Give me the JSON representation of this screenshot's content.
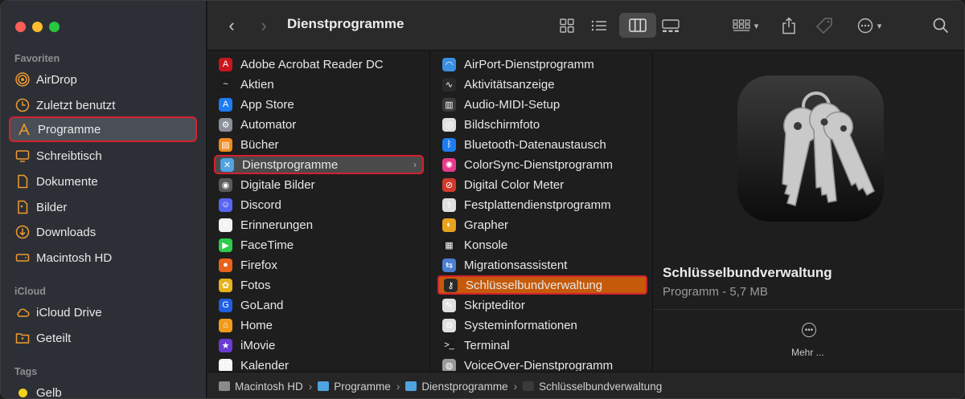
{
  "sidebar": {
    "sections": [
      {
        "label": "Favoriten"
      },
      {
        "label": "iCloud"
      },
      {
        "label": "Tags"
      }
    ],
    "favorites": [
      {
        "label": "AirDrop",
        "icon": "airdrop-icon"
      },
      {
        "label": "Zuletzt benutzt",
        "icon": "clock-icon"
      },
      {
        "label": "Programme",
        "icon": "applications-icon",
        "selected": true
      },
      {
        "label": "Schreibtisch",
        "icon": "desktop-icon"
      },
      {
        "label": "Dokumente",
        "icon": "document-icon"
      },
      {
        "label": "Bilder",
        "icon": "pictures-icon"
      },
      {
        "label": "Downloads",
        "icon": "downloads-icon"
      },
      {
        "label": "Macintosh HD",
        "icon": "harddrive-icon"
      }
    ],
    "icloud": [
      {
        "label": "iCloud Drive",
        "icon": "cloud-icon"
      },
      {
        "label": "Geteilt",
        "icon": "shared-folder-icon"
      }
    ],
    "tags": [
      {
        "label": "Gelb",
        "color": "#f2d11c"
      }
    ]
  },
  "toolbar": {
    "title": "Dienstprogramme"
  },
  "column1": [
    {
      "label": "Adobe Acrobat Reader DC",
      "color": "#c8161d",
      "glyph": "A"
    },
    {
      "label": "Aktien",
      "color": "#1c1c1c",
      "glyph": "~"
    },
    {
      "label": "App Store",
      "color": "#1e7cf2",
      "glyph": "A"
    },
    {
      "label": "Automator",
      "color": "#8a8f99",
      "glyph": "⚙"
    },
    {
      "label": "Bücher",
      "color": "#f08a1c",
      "glyph": "▤"
    },
    {
      "label": "Dienstprogramme",
      "color": "#4fa3e0",
      "glyph": "✕",
      "selected": true
    },
    {
      "label": "Digitale Bilder",
      "color": "#5a5a5a",
      "glyph": "◉"
    },
    {
      "label": "Discord",
      "color": "#5865f2",
      "glyph": "☺"
    },
    {
      "label": "Erinnerungen",
      "color": "#f2f2f2",
      "glyph": "≡"
    },
    {
      "label": "FaceTime",
      "color": "#2ecc4a",
      "glyph": "▶"
    },
    {
      "label": "Firefox",
      "color": "#e8621c",
      "glyph": "●"
    },
    {
      "label": "Fotos",
      "color": "#e8b21c",
      "glyph": "✿"
    },
    {
      "label": "GoLand",
      "color": "#1f5fe0",
      "glyph": "G"
    },
    {
      "label": "Home",
      "color": "#f29a1c",
      "glyph": "⌂"
    },
    {
      "label": "iMovie",
      "color": "#6a3bd1",
      "glyph": "★"
    },
    {
      "label": "Kalender",
      "color": "#f5f5f5",
      "glyph": "17"
    }
  ],
  "column2": [
    {
      "label": "AirPort-Dienstprogramm",
      "color": "#3b8fe0",
      "glyph": "◠"
    },
    {
      "label": "Aktivitätsanzeige",
      "color": "#2a2a2a",
      "glyph": "∿"
    },
    {
      "label": "Audio-MIDI-Setup",
      "color": "#3a3a3a",
      "glyph": "▥"
    },
    {
      "label": "Bildschirmfoto",
      "color": "#e0e0e0",
      "glyph": "◎"
    },
    {
      "label": "Bluetooth-Datenaustausch",
      "color": "#1e7cf2",
      "glyph": "ᛒ"
    },
    {
      "label": "ColorSync-Dienstprogramm",
      "color": "#e83a8a",
      "glyph": "✺"
    },
    {
      "label": "Digital Color Meter",
      "color": "#d13a2a",
      "glyph": "⊘"
    },
    {
      "label": "Festplattendienstprogramm",
      "color": "#e0e0e0",
      "glyph": "⚕"
    },
    {
      "label": "Grapher",
      "color": "#e8a21c",
      "glyph": "◐"
    },
    {
      "label": "Konsole",
      "color": "#1c1c1c",
      "glyph": "▦"
    },
    {
      "label": "Migrationsassistent",
      "color": "#4a7fd1",
      "glyph": "⇆"
    },
    {
      "label": "Schlüsselbundverwaltung",
      "color": "#2a2a2a",
      "glyph": "⚷",
      "selected": true
    },
    {
      "label": "Skripteditor",
      "color": "#e0e0e0",
      "glyph": "✎"
    },
    {
      "label": "Systeminformationen",
      "color": "#e0e0e0",
      "glyph": "⚙"
    },
    {
      "label": "Terminal",
      "color": "#1c1c1c",
      "glyph": ">_"
    },
    {
      "label": "VoiceOver-Dienstprogramm",
      "color": "#9a9a9a",
      "glyph": "◍"
    }
  ],
  "preview": {
    "name": "Schlüsselbundverwaltung",
    "subtitle": "Programm - 5,7 MB",
    "more_label": "Mehr ..."
  },
  "pathbar": [
    {
      "label": "Macintosh HD",
      "color": "#8a8a8a"
    },
    {
      "label": "Programme",
      "color": "#4fa3e0"
    },
    {
      "label": "Dienstprogramme",
      "color": "#4fa3e0"
    },
    {
      "label": "Schlüsselbundverwaltung",
      "color": "#3a3a3a"
    }
  ]
}
